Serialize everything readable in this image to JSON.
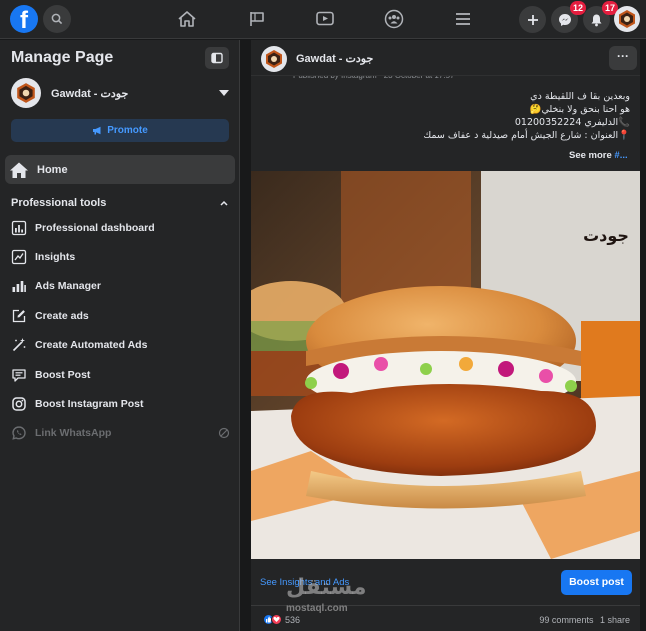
{
  "topbar": {
    "logo_letter": "f",
    "messenger_badge": "12",
    "notifications_badge": "17"
  },
  "sidebar": {
    "title": "Manage Page",
    "page_name": "Gawdat - جودت",
    "promote_label": "Promote",
    "home_label": "Home",
    "section_title": "Professional tools",
    "tools": [
      {
        "label": "Professional dashboard",
        "icon": "dashboard-icon",
        "enabled": true
      },
      {
        "label": "Insights",
        "icon": "insights-icon",
        "enabled": true
      },
      {
        "label": "Ads Manager",
        "icon": "ads-manager-icon",
        "enabled": true
      },
      {
        "label": "Create ads",
        "icon": "edit-icon",
        "enabled": true
      },
      {
        "label": "Create Automated Ads",
        "icon": "magic-wand-icon",
        "enabled": true
      },
      {
        "label": "Boost Post",
        "icon": "boost-post-icon",
        "enabled": true
      },
      {
        "label": "Boost Instagram Post",
        "icon": "instagram-icon",
        "enabled": true
      },
      {
        "label": "Link WhatsApp",
        "icon": "whatsapp-icon",
        "enabled": false
      }
    ]
  },
  "post": {
    "page_name": "Gawdat - جودت",
    "meta": "Published by Instagram · 23 October at 17:57 ·",
    "caption_lines": [
      "وبعدين بقا ف اللقيطة دي",
      "هو احنا بنحق ولا بنخلي🤔",
      "",
      "📞الدليفري 01200352224",
      "📍العنوان : شارع الجيش أمام صيدلية  د عفاف سمك"
    ],
    "see_more": "See more",
    "hashtag": "#...",
    "photo_logo_text": "جودت",
    "insights_link": "See Insights and Ads",
    "boost_label": "Boost post",
    "reactions_count": "536",
    "comments": "99 comments",
    "shares": "1 share"
  },
  "watermark": {
    "arabic": "مستقل",
    "latin": "mostaql.com"
  },
  "colors": {
    "brand": "#1877f2",
    "link": "#4599ff",
    "badge": "#e41e3f",
    "background": "#18191a",
    "surface": "#242526"
  }
}
